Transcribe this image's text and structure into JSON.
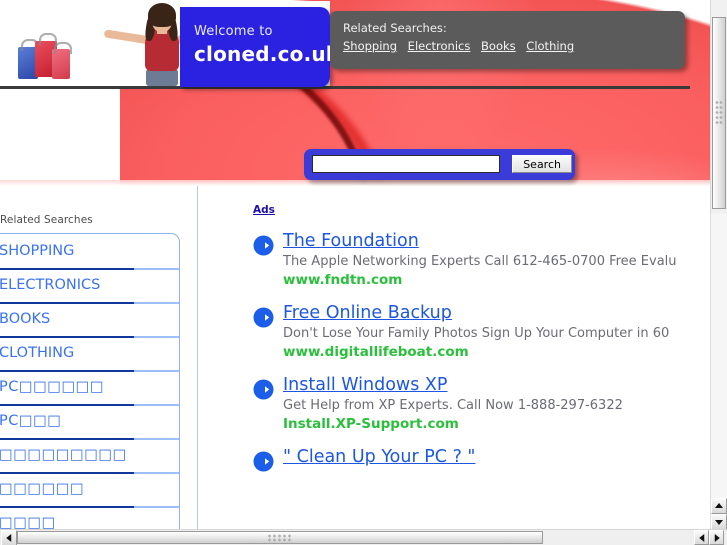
{
  "banner": {
    "welcome_small": "Welcome to",
    "welcome_big": "cloned.co.uk",
    "related_title": "Related Searches:",
    "related_links": [
      "Shopping",
      "Electronics",
      "Books",
      "Clothing"
    ],
    "photo_alt": "woman-holding-shopping-bags"
  },
  "search": {
    "value": "",
    "placeholder": "",
    "button_label": "Search"
  },
  "sidebar": {
    "heading": "Related Searches",
    "items": [
      {
        "label": "SHOPPING"
      },
      {
        "label": "ELECTRONICS"
      },
      {
        "label": "BOOKS"
      },
      {
        "label": "CLOTHING"
      },
      {
        "label": "PC□□□□□□"
      },
      {
        "label": "PC□□□"
      },
      {
        "label": "□□□□□□□□□"
      },
      {
        "label": "□□□□□□"
      },
      {
        "label": "□□□□"
      }
    ]
  },
  "ads": {
    "label": "Ads",
    "items": [
      {
        "title": "The Foundation",
        "desc": "The Apple Networking Experts Call 612-465-0700 Free Evalu",
        "url": "www.fndtn.com"
      },
      {
        "title": "Free Online Backup",
        "desc": "Don't Lose Your Family Photos Sign Up Your Computer in 60",
        "url": "www.digitallifeboat.com"
      },
      {
        "title": "Install Windows XP",
        "desc": "Get Help from XP Experts. Call Now 1-888-297-6322",
        "url": "Install.XP-Support.com"
      },
      {
        "title": "\" Clean Up Your PC ? \"",
        "desc": "",
        "url": ""
      }
    ]
  },
  "colors": {
    "brand_blue": "#2a22e0",
    "panel_blue": "#3b3bd8",
    "link_blue": "#1d56e0",
    "url_green": "#2bbf3c",
    "hero_red": "#fb5f5f",
    "related_bar_gray": "#5b5b5b"
  },
  "scrollbars": {
    "vertical_arrow_up": "scroll-up",
    "vertical_arrow_down": "scroll-down",
    "horizontal_arrow_left": "scroll-left",
    "horizontal_arrow_right": "scroll-right"
  }
}
